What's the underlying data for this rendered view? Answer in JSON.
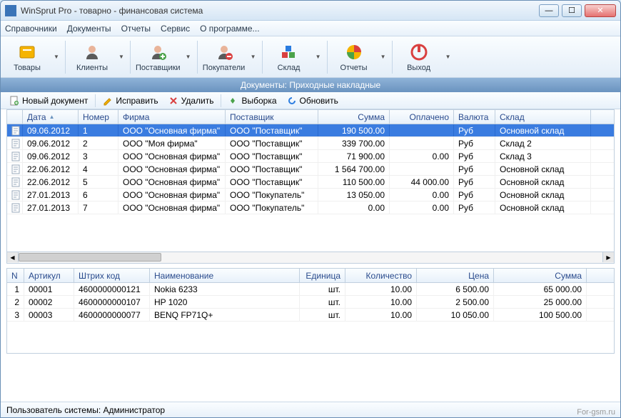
{
  "window": {
    "title": "WinSprut Pro - товарно - финансовая система"
  },
  "menu": [
    "Справочники",
    "Документы",
    "Отчеты",
    "Сервис",
    "О программе..."
  ],
  "toolbar": [
    {
      "label": "Товары",
      "icon": "goods-icon",
      "color": "#f5b400"
    },
    {
      "label": "Клиенты",
      "icon": "clients-icon",
      "color": "#d86b5a"
    },
    {
      "label": "Поставщики",
      "icon": "suppliers-icon",
      "color": "#d86b5a"
    },
    {
      "label": "Покупатели",
      "icon": "buyers-icon",
      "color": "#d86b5a"
    },
    {
      "label": "Склад",
      "icon": "warehouse-icon",
      "color": "#4aa24a"
    },
    {
      "label": "Отчеты",
      "icon": "reports-icon",
      "color": "#e04040"
    },
    {
      "label": "Выход",
      "icon": "exit-icon",
      "color": "#d94040"
    }
  ],
  "section_title": "Документы: Приходные накладные",
  "actions": {
    "new": "Новый документ",
    "edit": "Исправить",
    "delete": "Удалить",
    "filter": "Выборка",
    "refresh": "Обновить"
  },
  "top_columns": [
    "Дата",
    "Номер",
    "Фирма",
    "Поставщик",
    "Сумма",
    "Оплачено",
    "Валюта",
    "Склад"
  ],
  "top_rows": [
    {
      "date": "09.06.2012",
      "num": "1",
      "firm": "ООО \"Основная фирма\"",
      "supp": "ООО \"Поставщик\"",
      "sum": "190 500.00",
      "paid": "",
      "curr": "Руб",
      "stock": "Основной склад",
      "selected": true
    },
    {
      "date": "09.06.2012",
      "num": "2",
      "firm": "ООО \"Моя фирма\"",
      "supp": "ООО \"Поставщик\"",
      "sum": "339 700.00",
      "paid": "",
      "curr": "Руб",
      "stock": "Склад 2"
    },
    {
      "date": "09.06.2012",
      "num": "3",
      "firm": "ООО \"Основная фирма\"",
      "supp": "ООО \"Поставщик\"",
      "sum": "71 900.00",
      "paid": "0.00",
      "curr": "Руб",
      "stock": "Склад 3"
    },
    {
      "date": "22.06.2012",
      "num": "4",
      "firm": "ООО \"Основная фирма\"",
      "supp": "ООО \"Поставщик\"",
      "sum": "1 564 700.00",
      "paid": "",
      "curr": "Руб",
      "stock": "Основной склад"
    },
    {
      "date": "22.06.2012",
      "num": "5",
      "firm": "ООО \"Основная фирма\"",
      "supp": "ООО \"Поставщик\"",
      "sum": "110 500.00",
      "paid": "44 000.00",
      "curr": "Руб",
      "stock": "Основной склад"
    },
    {
      "date": "27.01.2013",
      "num": "6",
      "firm": "ООО \"Основная фирма\"",
      "supp": "ООО \"Покупатель\"",
      "sum": "13 050.00",
      "paid": "0.00",
      "curr": "Руб",
      "stock": "Основной склад"
    },
    {
      "date": "27.01.2013",
      "num": "7",
      "firm": "ООО \"Основная фирма\"",
      "supp": "ООО \"Покупатель\"",
      "sum": "0.00",
      "paid": "0.00",
      "curr": "Руб",
      "stock": "Основной склад"
    }
  ],
  "bottom_columns": [
    "N",
    "Артикул",
    "Штрих код",
    "Наименование",
    "Единица",
    "Количество",
    "Цена",
    "Сумма"
  ],
  "bottom_rows": [
    {
      "n": "1",
      "art": "00001",
      "bar": "4600000000121",
      "name": "Nokia 6233",
      "unit": "шт.",
      "qty": "10.00",
      "price": "6 500.00",
      "total": "65 000.00"
    },
    {
      "n": "2",
      "art": "00002",
      "bar": "4600000000107",
      "name": "HP 1020",
      "unit": "шт.",
      "qty": "10.00",
      "price": "2 500.00",
      "total": "25 000.00"
    },
    {
      "n": "3",
      "art": "00003",
      "bar": "4600000000077",
      "name": "BENQ FP71Q+",
      "unit": "шт.",
      "qty": "10.00",
      "price": "10 050.00",
      "total": "100 500.00"
    }
  ],
  "status": "Пользователь системы: Администратор",
  "watermark": "For-gsm.ru"
}
